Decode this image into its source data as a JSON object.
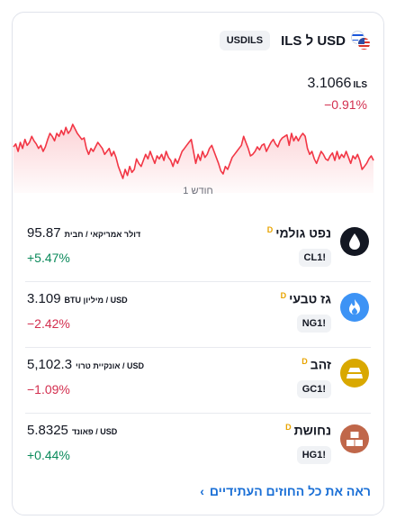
{
  "header": {
    "pair": "USD ל ILS",
    "badge": "USDILS",
    "price": "3.1066",
    "price_unit": "ILS",
    "change": "−0.91%"
  },
  "chart": {
    "period": "חודש 1",
    "values": [
      63,
      65,
      60,
      66,
      62,
      68,
      64,
      66,
      70,
      67,
      65,
      62,
      64,
      60,
      63,
      68,
      72,
      70,
      67,
      72,
      70,
      74,
      71,
      76,
      72,
      74,
      78,
      75,
      72,
      70,
      68,
      69,
      62,
      58,
      62,
      60,
      63,
      66,
      64,
      62,
      58,
      60,
      62,
      57,
      60,
      56,
      50,
      46,
      42,
      48,
      44,
      50,
      46,
      48,
      55,
      52,
      50,
      54,
      58,
      55,
      60,
      56,
      52,
      57,
      55,
      58,
      54,
      60,
      56,
      54,
      50,
      55,
      52,
      56,
      60,
      62,
      64,
      66,
      68,
      60,
      52,
      58,
      54,
      60,
      56,
      58,
      62,
      64,
      60,
      56,
      52,
      47,
      45,
      50,
      48,
      52,
      56,
      58,
      60,
      62,
      64,
      70,
      66,
      62,
      57,
      58,
      60,
      63,
      61,
      64,
      65,
      60,
      63,
      66,
      68,
      65,
      63,
      67,
      69,
      70,
      71,
      64,
      72,
      67,
      70,
      67,
      70,
      72,
      70,
      62,
      58,
      60,
      55,
      52,
      56,
      60,
      58,
      55,
      54,
      57,
      59,
      54,
      60,
      55,
      58,
      56,
      60,
      56,
      52,
      57,
      55,
      58,
      54,
      48,
      50,
      52,
      55,
      57,
      54
    ]
  },
  "rows": [
    {
      "name": "נפט גולמי",
      "code": "CL1!",
      "value": "95.87",
      "unit": "דולר אמריקאי / חבית",
      "change": "+5.47%",
      "dir": "pos",
      "icon": "oil-drop-icon",
      "color": "#131722"
    },
    {
      "name": "גז טבעי",
      "code": "NG1!",
      "value": "3.109",
      "unit": "USD / מיליון BTU",
      "change": "−2.42%",
      "dir": "neg",
      "icon": "flame-icon",
      "color": "#3d93f5"
    },
    {
      "name": "זהב",
      "code": "GC1!",
      "value": "5,102.3",
      "unit": "USD / אונקיית טרוי",
      "change": "−1.09%",
      "dir": "neg",
      "icon": "gold-bars-icon",
      "color": "#d9a800"
    },
    {
      "name": "נחושת",
      "code": "HG1!",
      "value": "5.8325",
      "unit": "USD / פאונד",
      "change": "+0.44%",
      "dir": "pos",
      "icon": "copper-bars-icon",
      "color": "#c0674a"
    }
  ],
  "footer": {
    "link": "ראה את כל החוזים העתידיים",
    "chevron": "›"
  },
  "delay_marker": "D"
}
